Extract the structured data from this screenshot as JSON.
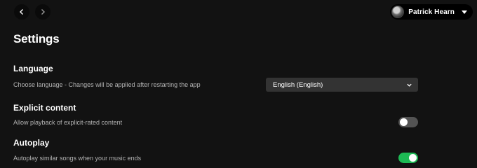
{
  "header": {
    "user_name": "Patrick Hearn"
  },
  "page": {
    "title": "Settings"
  },
  "language": {
    "title": "Language",
    "description": "Choose language - Changes will be applied after restarting the app",
    "selected": "English (English)"
  },
  "explicit": {
    "title": "Explicit content",
    "description": "Allow playback of explicit-rated content",
    "enabled": false
  },
  "autoplay": {
    "title": "Autoplay",
    "description": "Autoplay similar songs when your music ends",
    "enabled": true
  },
  "colors": {
    "background": "#121212",
    "accent": "#1db954",
    "toggle_off": "#535353",
    "select_bg": "#333333"
  }
}
